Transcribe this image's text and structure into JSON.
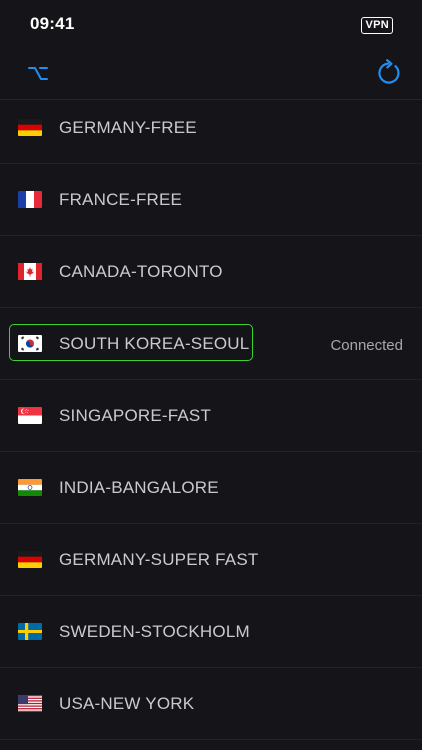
{
  "status_bar": {
    "time": "09:41",
    "vpn_badge": "VPN"
  },
  "nav": {
    "left_icon": "option-key-icon",
    "right_icon": "refresh-icon",
    "accent_color": "#1f8ef1"
  },
  "servers": [
    {
      "name": "GERMANY-FREE",
      "flag": "germany",
      "status": ""
    },
    {
      "name": "FRANCE-FREE",
      "flag": "france",
      "status": ""
    },
    {
      "name": "CANADA-TORONTO",
      "flag": "canada",
      "status": ""
    },
    {
      "name": "SOUTH KOREA-SEOUL",
      "flag": "south-korea",
      "status": "Connected",
      "selected": true
    },
    {
      "name": "SINGAPORE-FAST",
      "flag": "singapore",
      "status": ""
    },
    {
      "name": "INDIA-BANGALORE",
      "flag": "india",
      "status": ""
    },
    {
      "name": "GERMANY-SUPER FAST",
      "flag": "germany",
      "status": ""
    },
    {
      "name": "SWEDEN-STOCKHOLM",
      "flag": "sweden",
      "status": ""
    },
    {
      "name": "USA-NEW YORK",
      "flag": "usa",
      "status": ""
    }
  ],
  "colors": {
    "background": "#151519",
    "row_text": "#c9c9d0",
    "selection_border": "#3ed133",
    "connected_text": "#a6a6ae"
  }
}
